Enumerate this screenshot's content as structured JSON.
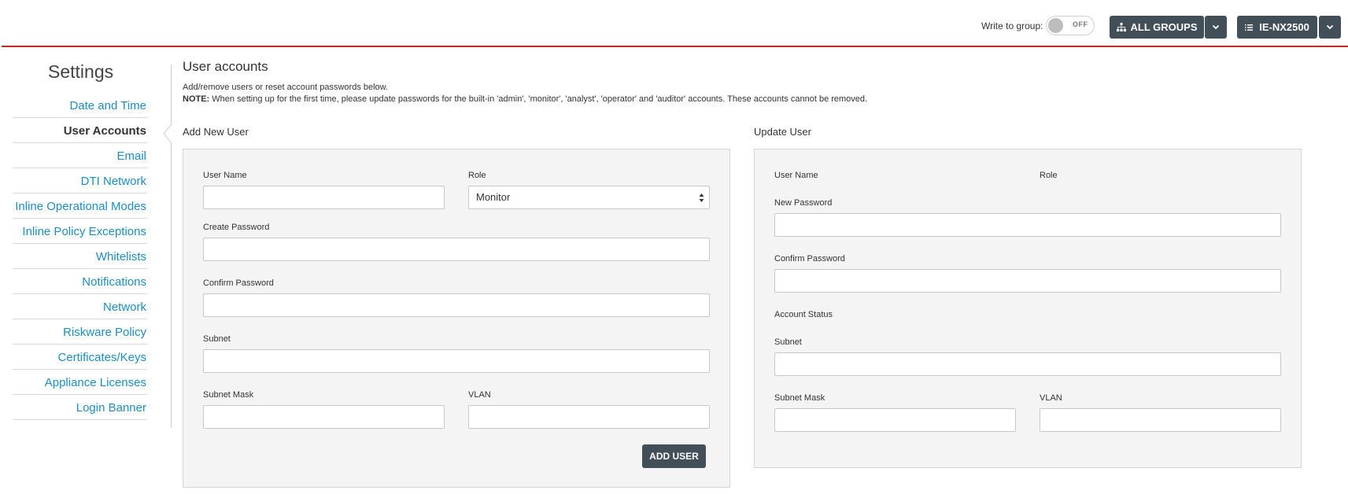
{
  "header": {
    "write_to_group_label": "Write to group:",
    "toggle_state": "OFF",
    "groups_button_label": "ALL GROUPS",
    "device_button_label": "IE-NX2500",
    "accent_color": "#c62828",
    "button_color": "#424e58"
  },
  "sidebar": {
    "title": "Settings",
    "items": [
      {
        "label": "Date and Time"
      },
      {
        "label": "User Accounts"
      },
      {
        "label": "Email"
      },
      {
        "label": "DTI Network"
      },
      {
        "label": "Inline Operational Modes"
      },
      {
        "label": "Inline Policy Exceptions"
      },
      {
        "label": "Whitelists"
      },
      {
        "label": "Notifications"
      },
      {
        "label": "Network"
      },
      {
        "label": "Riskware Policy"
      },
      {
        "label": "Certificates/Keys"
      },
      {
        "label": "Appliance Licenses"
      },
      {
        "label": "Login Banner"
      }
    ],
    "active": "User Accounts",
    "link_color": "#1a8fc4"
  },
  "main": {
    "heading": "User accounts",
    "description": "Add/remove users or reset account passwords below.",
    "note_label": "NOTE:",
    "note_text": " When setting up for the first time, please update passwords for the built-in 'admin', 'monitor', 'analyst', 'operator' and 'auditor' accounts. These accounts cannot be removed."
  },
  "add_user": {
    "title": "Add New User",
    "username_label": "User Name",
    "username_value": "",
    "role_label": "Role",
    "role_value": "Monitor",
    "create_password_label": "Create Password",
    "confirm_password_label": "Confirm Password",
    "subnet_label": "Subnet",
    "subnet_mask_label": "Subnet Mask",
    "vlan_label": "VLAN",
    "add_button_label": "ADD USER"
  },
  "update_user": {
    "title": "Update User",
    "username_label": "User Name",
    "role_label": "Role",
    "new_password_label": "New Password",
    "confirm_password_label": "Confirm Password",
    "account_status_label": "Account Status",
    "subnet_label": "Subnet",
    "subnet_mask_label": "Subnet Mask",
    "vlan_label": "VLAN"
  },
  "icons": {
    "groups": "sitemap-icon",
    "device": "list-icon",
    "dropdown": "chevron-down-icon",
    "select": "sort-arrows-icon"
  }
}
